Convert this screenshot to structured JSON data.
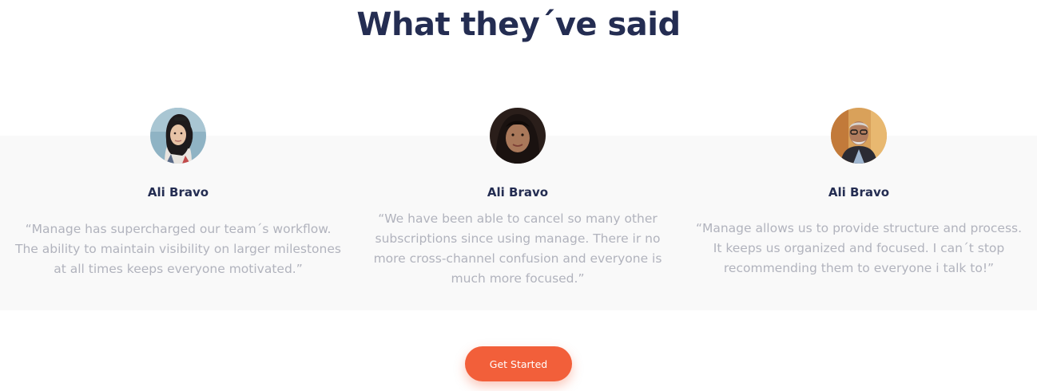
{
  "section": {
    "title": "What they´ve said"
  },
  "testimonials": [
    {
      "name": "Ali Bravo",
      "quote": "“Manage has supercharged our team´s workflow. The ability to maintain visibility on larger milestones at all times keeps everyone motivated.”"
    },
    {
      "name": "Ali Bravo",
      "quote": "“We have been able to cancel so many other subscriptions since using manage. There ir no more cross-channel confusion and everyone is much more focused.”"
    },
    {
      "name": "Ali Bravo",
      "quote": "“Manage allows us to provide structure and process. It keeps us organized and focused. I can´t stop recommending them to everyone i talk to!”"
    }
  ],
  "cta": {
    "label": "Get Started"
  },
  "colors": {
    "heading": "#242d52",
    "quote_text": "#b1b3bd",
    "band_background": "#f9f9f9",
    "cta_background": "#f25f3a"
  }
}
